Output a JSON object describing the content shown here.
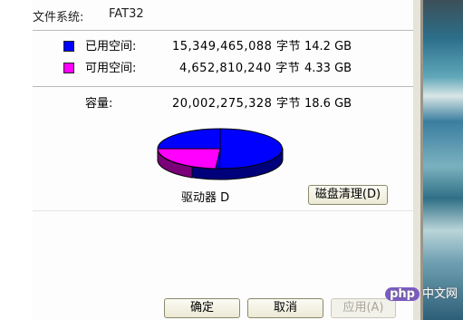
{
  "filesystem": {
    "label": "文件系统:",
    "value": "FAT32"
  },
  "used": {
    "label": "已用空间:",
    "bytes": "15,349,465,088 字节",
    "gb": "14.2 GB",
    "color": "#0000ff"
  },
  "free": {
    "label": "可用空间:",
    "bytes": "4,652,810,240 字节",
    "gb": "4.33 GB",
    "color": "#ff00ff"
  },
  "capacity": {
    "label": "容量:",
    "bytes": "20,002,275,328 字节",
    "gb": "18.6 GB"
  },
  "drive": {
    "label": "驱动器 D"
  },
  "buttons": {
    "cleanup": "磁盘清理(D)",
    "ok": "确定",
    "cancel": "取消",
    "apply": "应用(A)"
  },
  "watermark": {
    "logo": "php",
    "text": "中文网"
  }
}
